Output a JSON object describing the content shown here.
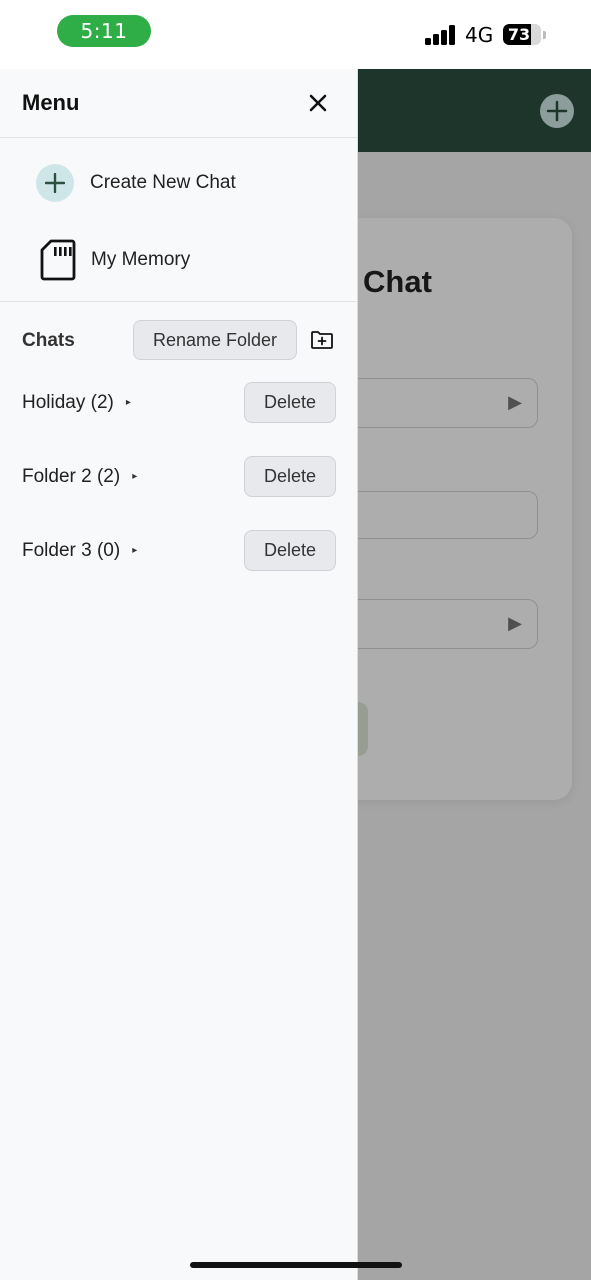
{
  "status_bar": {
    "time": "5:11",
    "network": "4G",
    "battery_percent": "73",
    "battery_level": 0.73
  },
  "background": {
    "card_title": "Chat",
    "add_icon": "plus-icon",
    "field_arrow": "▶"
  },
  "drawer": {
    "title": "Menu",
    "close_icon": "close-icon",
    "menu_items": [
      {
        "label": "Create New Chat",
        "icon": "plus-icon"
      },
      {
        "label": "My Memory",
        "icon": "sd-card-icon"
      }
    ],
    "chats_label": "Chats",
    "rename_folder_label": "Rename Folder",
    "new_folder_icon": "folder-plus-icon",
    "folders": [
      {
        "name": "Holiday (2)",
        "caret": "▸",
        "delete_label": "Delete"
      },
      {
        "name": "Folder 2 (2)",
        "caret": "▸",
        "delete_label": "Delete"
      },
      {
        "name": "Folder 3 (0)",
        "caret": "▸",
        "delete_label": "Delete"
      }
    ]
  },
  "colors": {
    "header_bg": "#2c4f3e",
    "time_pill": "#2fae48",
    "drawer_bg": "#f8f9fb",
    "plus_circle": "#cfe6e8",
    "button_bg": "#e7e9ed"
  }
}
